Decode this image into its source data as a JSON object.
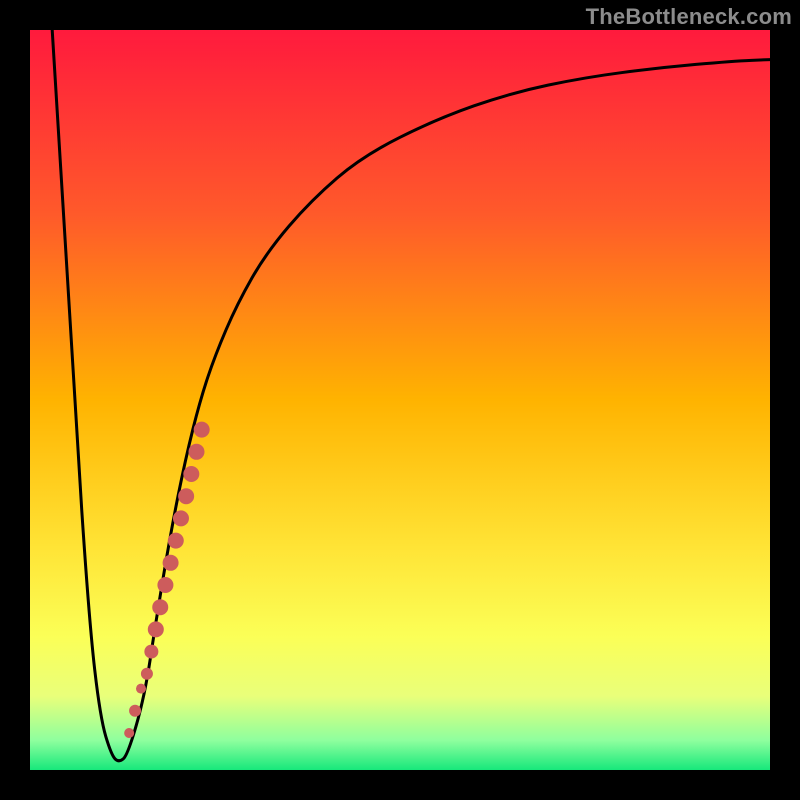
{
  "watermark": "TheBottleneck.com",
  "chart_data": {
    "type": "line",
    "title": "",
    "xlabel": "",
    "ylabel": "",
    "xlim": [
      0,
      100
    ],
    "ylim": [
      0,
      100
    ],
    "gradient_stops": [
      {
        "offset": 0.0,
        "color": "#ff1a3d"
      },
      {
        "offset": 0.25,
        "color": "#ff5a2a"
      },
      {
        "offset": 0.5,
        "color": "#ffb300"
      },
      {
        "offset": 0.7,
        "color": "#ffe436"
      },
      {
        "offset": 0.82,
        "color": "#fbff57"
      },
      {
        "offset": 0.9,
        "color": "#e9ff7a"
      },
      {
        "offset": 0.96,
        "color": "#8eff9e"
      },
      {
        "offset": 1.0,
        "color": "#17e87b"
      }
    ],
    "series": [
      {
        "name": "curve",
        "x": [
          3,
          6,
          8,
          9.5,
          11,
          12,
          13.2,
          15.5,
          17,
          19,
          21,
          23,
          25,
          28,
          32,
          38,
          45,
          55,
          65,
          75,
          85,
          95,
          100
        ],
        "y": [
          100,
          50,
          20,
          7,
          2,
          1,
          2,
          10,
          20,
          32,
          42,
          50,
          56,
          63,
          70,
          77,
          83,
          88,
          91.5,
          93.6,
          94.9,
          95.8,
          96
        ]
      }
    ],
    "dotted_segment": {
      "name": "highlight-dots",
      "color": "#cd5c5c",
      "points": [
        {
          "x": 13.4,
          "y": 5,
          "r": 5
        },
        {
          "x": 14.2,
          "y": 8,
          "r": 6
        },
        {
          "x": 15.0,
          "y": 11,
          "r": 5
        },
        {
          "x": 15.8,
          "y": 13,
          "r": 6
        },
        {
          "x": 16.4,
          "y": 16,
          "r": 7
        },
        {
          "x": 17.0,
          "y": 19,
          "r": 8
        },
        {
          "x": 17.6,
          "y": 22,
          "r": 8
        },
        {
          "x": 18.3,
          "y": 25,
          "r": 8
        },
        {
          "x": 19.0,
          "y": 28,
          "r": 8
        },
        {
          "x": 19.7,
          "y": 31,
          "r": 8
        },
        {
          "x": 20.4,
          "y": 34,
          "r": 8
        },
        {
          "x": 21.1,
          "y": 37,
          "r": 8
        },
        {
          "x": 21.8,
          "y": 40,
          "r": 8
        },
        {
          "x": 22.5,
          "y": 43,
          "r": 8
        },
        {
          "x": 23.2,
          "y": 46,
          "r": 8
        }
      ]
    }
  }
}
